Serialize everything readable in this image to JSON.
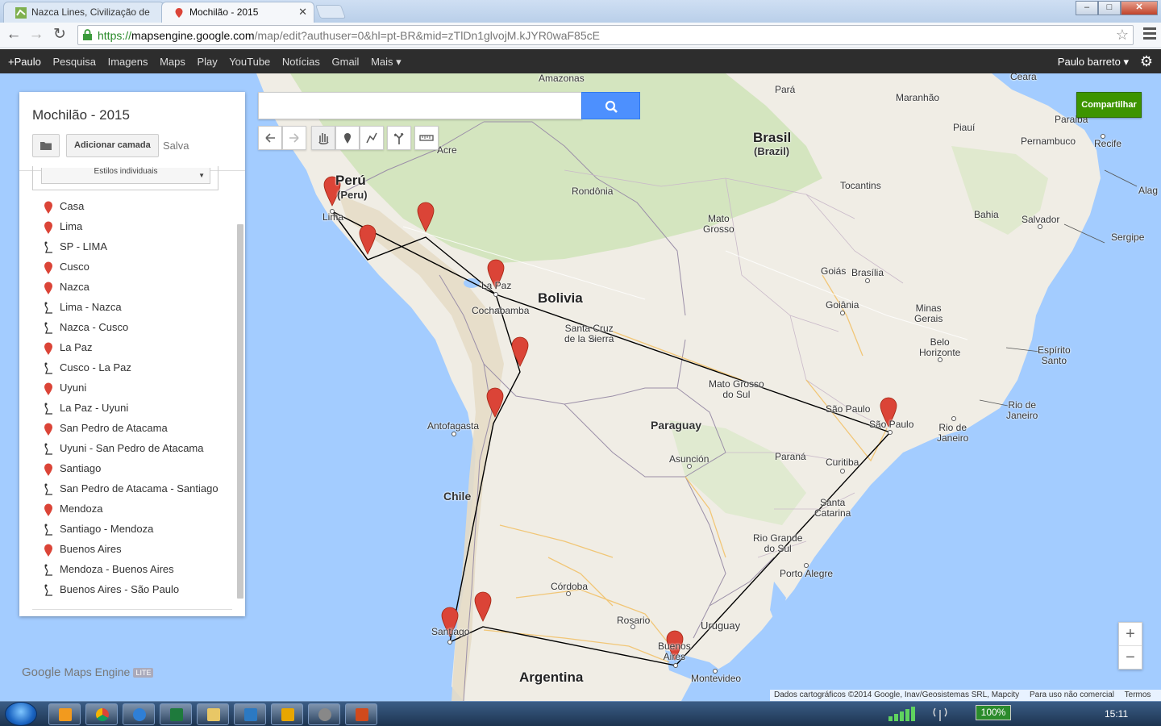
{
  "browser": {
    "tabs": [
      {
        "title": "Nazca Lines, Civilização de"
      },
      {
        "title": "Mochilão - 2015"
      }
    ],
    "url": {
      "proto": "https://",
      "host": "mapsengine.google.com",
      "path": "/map/edit?authuser=0&hl=pt-BR&mid=zTlDn1glvojM.kJYR0waF85cE"
    },
    "window_controls": {
      "minimize": "–",
      "maximize": "□",
      "close": "✕"
    }
  },
  "gbar": {
    "links": [
      "+Paulo",
      "Pesquisa",
      "Imagens",
      "Maps",
      "Play",
      "YouTube",
      "Notícias",
      "Gmail",
      "Mais ▾"
    ],
    "user": "Paulo barreto ▾"
  },
  "panel": {
    "map_title": "Mochilão - 2015",
    "add_layer_label": "Adicionar camada",
    "saved_label": "Salva",
    "style_select": "Estilos individuais",
    "items": [
      {
        "label": "Casa",
        "type": "marker"
      },
      {
        "label": "Lima",
        "type": "marker"
      },
      {
        "label": "SP - LIMA",
        "type": "line"
      },
      {
        "label": "Cusco",
        "type": "marker"
      },
      {
        "label": "Nazca",
        "type": "marker"
      },
      {
        "label": "Lima - Nazca",
        "type": "line"
      },
      {
        "label": "Nazca - Cusco",
        "type": "line"
      },
      {
        "label": "La Paz",
        "type": "marker"
      },
      {
        "label": "Cusco - La Paz",
        "type": "line"
      },
      {
        "label": "Uyuni",
        "type": "marker"
      },
      {
        "label": "La Paz - Uyuni",
        "type": "line"
      },
      {
        "label": "San Pedro de Atacama",
        "type": "marker"
      },
      {
        "label": "Uyuni - San Pedro de Atacama",
        "type": "line"
      },
      {
        "label": "Santiago",
        "type": "marker"
      },
      {
        "label": "San Pedro de Atacama - Santiago",
        "type": "line"
      },
      {
        "label": "Mendoza",
        "type": "marker"
      },
      {
        "label": "Santiago - Mendoza",
        "type": "line"
      },
      {
        "label": "Buenos Aires",
        "type": "marker"
      },
      {
        "label": "Mendoza - Buenos Aires",
        "type": "line"
      },
      {
        "label": "Buenos Aires - São Paulo",
        "type": "line"
      }
    ]
  },
  "map": {
    "share_label": "Compartilhar",
    "search_placeholder": "",
    "zoom_in": "+",
    "zoom_out": "−",
    "logo": {
      "google": "Google",
      "product": "Maps Engine",
      "badge": "LITE"
    },
    "attribution": [
      "Dados cartográficos ©2014 Google, Inav/Geosistemas SRL, Mapcity",
      "Para uso não comercial",
      "Termos"
    ],
    "labels": {
      "amazonas": "Amazonas",
      "para": "Pará",
      "maranhao": "Maranhão",
      "ceara": "Ceara",
      "paraiba": "Paraiba",
      "piaui": "Piauí",
      "pernambuco": "Pernambuco",
      "recife": "Recife",
      "brasil": "Brasil",
      "brazil": "(Brazil)",
      "acre": "Acre",
      "peru": "Perú",
      "peru_en": "(Peru)",
      "lima": "Lima",
      "rondonia": "Rondônia",
      "tocantins": "Tocantins",
      "bahia": "Bahia",
      "salvador": "Salvador",
      "alag": "Alag",
      "sergipe": "Sergipe",
      "mato_grosso": "Mato\nGrosso",
      "goias": "Goiás",
      "brasilia": "Brasília",
      "goiania": "Goiânia",
      "la_paz": "La Paz",
      "bolivia": "Bolivia",
      "cochabamba": "Cochabamba",
      "santa_cruz": "Santa Cruz\nde la Sierra",
      "minas_gerais": "Minas\nGerais",
      "belo_horizonte": "Belo\nHorizonte",
      "espirito_santo": "Espírito\nSanto",
      "mato_grosso_sul": "Mato Grosso\ndo Sul",
      "sao_paulo_state": "São Paulo",
      "sao_paulo_city": "São Paulo",
      "rio_state": "Rio de\nJaneiro",
      "rio_city": "Rio de\nJaneiro",
      "antofagasta": "Antofagasta",
      "paraguay": "Paraguay",
      "asuncion": "Asunción",
      "parana": "Paraná",
      "curitiba": "Curitiba",
      "chile": "Chile",
      "santa_catarina": "Santa\nCatarina",
      "rio_grande": "Rio Grande\ndo Sul",
      "porto_alegre": "Porto Alegre",
      "cordoba": "Córdoba",
      "rosario": "Rosario",
      "uruguay": "Uruguay",
      "santiago": "Santiago",
      "buenos_aires": "Buenos\nAires",
      "montevideo": "Montevideo",
      "argentina": "Argentina"
    }
  },
  "taskbar": {
    "battery": "100%",
    "clock": "15:11"
  },
  "colors": {
    "water": "#a3ccff",
    "land": "#f0ede5",
    "accent_blue": "#4d90fe",
    "share_green": "#3d9400",
    "marker_red": "#db4437"
  }
}
